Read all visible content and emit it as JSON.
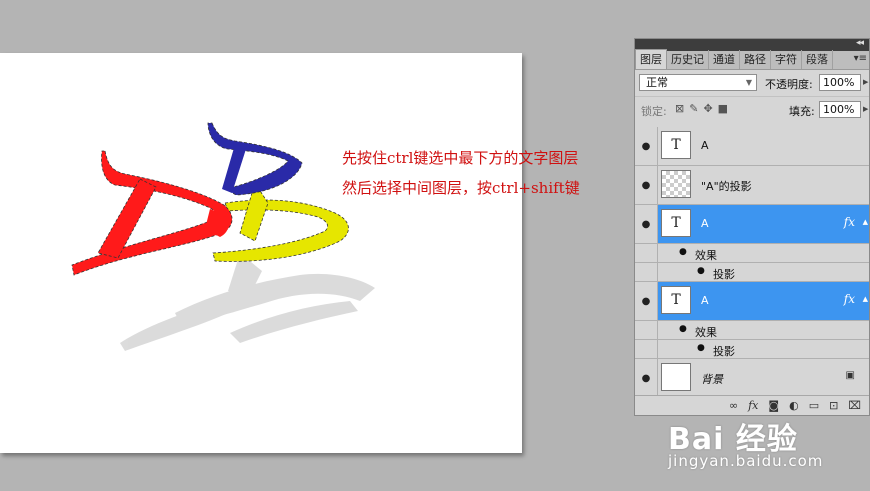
{
  "canvas": {
    "instruction_line1": "先按住ctrl键选中最下方的文字图层",
    "instruction_line2": "然后选择中间图层，按ctrl+shift键"
  },
  "layers_panel": {
    "tabs": [
      "图层",
      "历史记",
      "通道",
      "路径",
      "字符",
      "段落"
    ],
    "collapse_glyph": "◂◂",
    "menu_glyph": "▾≡",
    "blend_mode": "正常",
    "opacity_label": "不透明度:",
    "opacity_value": "100%",
    "lock_label": "锁定:",
    "fill_label": "填充:",
    "fill_value": "100%",
    "layers": [
      {
        "name": "A",
        "thumb": "T",
        "selected": false
      },
      {
        "name": "\"A\"的投影",
        "thumb": "",
        "selected": false
      },
      {
        "name": "A",
        "thumb": "T",
        "selected": true,
        "fx": "fx",
        "effects_label": "效果",
        "effect": "投影"
      },
      {
        "name": "A",
        "thumb": "T",
        "selected": true,
        "fx": "fx",
        "effects_label": "效果",
        "effect": "投影"
      },
      {
        "name": "背景",
        "thumb": "",
        "selected": false
      }
    ],
    "bottom_fx": "fx"
  },
  "watermark": {
    "logo": "Bai 经验",
    "url": "jingyan.baidu.com"
  },
  "colors": {
    "red": "#ff1a1a",
    "yellow": "#e6e600",
    "blue": "#2a2aa8",
    "selection_blue": "#3d95f0",
    "note_red": "#d01010"
  }
}
